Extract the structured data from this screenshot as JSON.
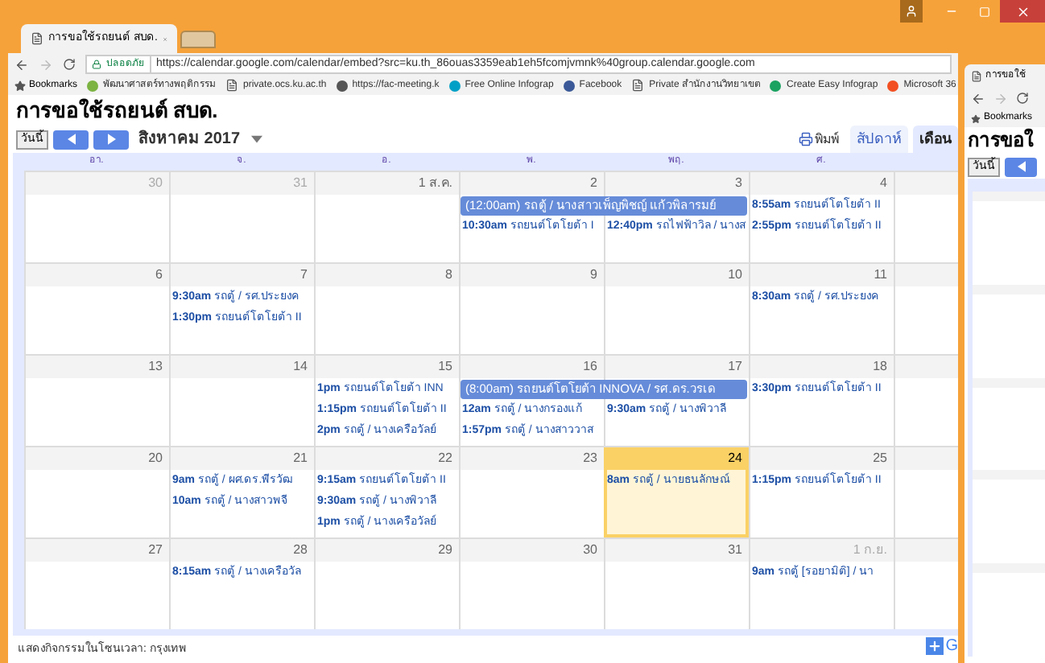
{
  "browser": {
    "tabs": [
      {
        "title": "การขอใช้รถยนต์ สบด.",
        "selected": true
      },
      {
        "selected": false
      }
    ],
    "address": {
      "secure_label": "ปลอดภัย",
      "url": "https://calendar.google.com/calendar/embed?src=ku.th_86ouas3359eab1eh5fcomjvmnk%40group.calendar.google.com"
    },
    "bookmarks_label": "Bookmarks",
    "bookmarks": [
      {
        "kind": "badge",
        "color": "#7cb342",
        "label": "พัฒนาศาสตร์ทางพฤติกรรม"
      },
      {
        "kind": "doc",
        "label": "private.ocs.ku.ac.th"
      },
      {
        "kind": "badge",
        "color": "#555555",
        "label": "https://fac-meeting.k"
      },
      {
        "kind": "badge",
        "color": "#00a0c6",
        "label": "Free Online Infograp"
      },
      {
        "kind": "badge",
        "color": "#3b5998",
        "label": "Facebook"
      },
      {
        "kind": "doc",
        "label": "Private สำนักงานวิทยาเขต"
      },
      {
        "kind": "badge",
        "color": "#1aa260",
        "label": "Create Easy Infograp"
      },
      {
        "kind": "badge",
        "color": "#f25022",
        "label": "Microsoft 36"
      }
    ]
  },
  "page": {
    "title": "การขอใช้รถยนต์ สบด.",
    "today_button": "วันนี้",
    "month": "สิงหาคม 2017",
    "print": "พิมพ์",
    "view_tabs": [
      {
        "label": "สัปดาห์",
        "selected": false
      },
      {
        "label": "เดือน",
        "selected": true
      }
    ]
  },
  "calendar": {
    "weekdays": [
      "อา.",
      "จ.",
      "อ.",
      "พ.",
      "พฤ.",
      "ศ."
    ],
    "weeks": [
      {
        "days": [
          {
            "date": "30",
            "other_month": true,
            "today": false
          },
          {
            "date": "31",
            "other_month": true,
            "today": false
          },
          {
            "date": "1 ส.ค.",
            "other_month": false,
            "today": false
          },
          {
            "date": "2",
            "other_month": false,
            "today": false,
            "events": [
              {
                "kind": "multiday",
                "title": "(12:00am) รถตู้ / นางสาวเพ็ญพิชญ์ แก้วพิลารมย์"
              },
              {
                "kind": "timed",
                "time": "10:30am",
                "title": "รถยนต์โตโยต้า I"
              }
            ]
          },
          {
            "date": "3",
            "other_month": false,
            "today": false,
            "events": [
              {
                "kind": "continued"
              },
              {
                "kind": "timed",
                "time": "12:40pm",
                "title": "รถไฟฟ้าวิล / นางส"
              }
            ]
          },
          {
            "date": "4",
            "other_month": false,
            "today": false,
            "events": [
              {
                "kind": "timed",
                "time": "8:55am",
                "title": "รถยนต์โตโยต้า II"
              },
              {
                "kind": "timed",
                "time": "2:55pm",
                "title": "รถยนต์โตโยต้า II"
              }
            ]
          }
        ]
      },
      {
        "days": [
          {
            "date": "6",
            "other_month": false,
            "today": false
          },
          {
            "date": "7",
            "other_month": false,
            "today": false,
            "events": [
              {
                "kind": "timed",
                "time": "9:30am",
                "title": "รถตู้ / รศ.ประยงค"
              },
              {
                "kind": "timed",
                "time": "1:30pm",
                "title": "รถยนต์โตโยต้า II"
              }
            ]
          },
          {
            "date": "8",
            "other_month": false,
            "today": false
          },
          {
            "date": "9",
            "other_month": false,
            "today": false
          },
          {
            "date": "10",
            "other_month": false,
            "today": false
          },
          {
            "date": "11",
            "other_month": false,
            "today": false,
            "events": [
              {
                "kind": "timed",
                "time": "8:30am",
                "title": "รถตู้ / รศ.ประยงค"
              }
            ]
          }
        ]
      },
      {
        "days": [
          {
            "date": "13",
            "other_month": false,
            "today": false
          },
          {
            "date": "14",
            "other_month": false,
            "today": false
          },
          {
            "date": "15",
            "other_month": false,
            "today": false,
            "events": [
              {
                "kind": "timed",
                "time": "1pm",
                "title": "รถยนต์โตโยต้า INN"
              },
              {
                "kind": "timed",
                "time": "1:15pm",
                "title": "รถยนต์โตโยต้า II"
              },
              {
                "kind": "timed",
                "time": "2pm",
                "title": "รถตู้ / นางเครือวัลย์"
              }
            ]
          },
          {
            "date": "16",
            "other_month": false,
            "today": false,
            "events": [
              {
                "kind": "multiday",
                "title": "(8:00am) รถยนต์โตโยต้า INNOVA / รศ.ดร.วรเด"
              },
              {
                "kind": "timed",
                "time": "12am",
                "title": "รถตู้ / นางกรองแก้"
              },
              {
                "kind": "timed",
                "time": "1:57pm",
                "title": "รถตู้ / นางสาววาส"
              }
            ]
          },
          {
            "date": "17",
            "other_month": false,
            "today": false,
            "events": [
              {
                "kind": "continued"
              },
              {
                "kind": "timed",
                "time": "9:30am",
                "title": "รถตู้ / นางพิวาลี"
              }
            ]
          },
          {
            "date": "18",
            "other_month": false,
            "today": false,
            "events": [
              {
                "kind": "timed",
                "time": "3:30pm",
                "title": "รถยนต์โตโยต้า II"
              }
            ]
          }
        ]
      },
      {
        "days": [
          {
            "date": "20",
            "other_month": false,
            "today": false
          },
          {
            "date": "21",
            "other_month": false,
            "today": false,
            "events": [
              {
                "kind": "timed",
                "time": "9am",
                "title": "รถตู้ / ผศ.ดร.พีรวัฒ"
              },
              {
                "kind": "timed",
                "time": "10am",
                "title": "รถตู้ / นางสาวพจี"
              }
            ]
          },
          {
            "date": "22",
            "other_month": false,
            "today": false,
            "events": [
              {
                "kind": "timed",
                "time": "9:15am",
                "title": "รถยนต์โตโยต้า II"
              },
              {
                "kind": "timed",
                "time": "9:30am",
                "title": "รถตู้ / นางพิวาลี"
              },
              {
                "kind": "timed",
                "time": "1pm",
                "title": "รถตู้ / นางเครือวัลย์"
              }
            ]
          },
          {
            "date": "23",
            "other_month": false,
            "today": false
          },
          {
            "date": "24",
            "other_month": false,
            "today": true,
            "events": [
              {
                "kind": "timed",
                "time": "8am",
                "title": "รถตู้ / นายธนลักษณ์"
              }
            ]
          },
          {
            "date": "25",
            "other_month": false,
            "today": false,
            "events": [
              {
                "kind": "timed",
                "time": "1:15pm",
                "title": "รถยนต์โตโยต้า II"
              }
            ]
          }
        ]
      },
      {
        "days": [
          {
            "date": "27",
            "other_month": false,
            "today": false
          },
          {
            "date": "28",
            "other_month": false,
            "today": false,
            "events": [
              {
                "kind": "timed",
                "time": "8:15am",
                "title": "รถตู้ / นางเครือวัล"
              }
            ]
          },
          {
            "date": "29",
            "other_month": false,
            "today": false
          },
          {
            "date": "30",
            "other_month": false,
            "today": false
          },
          {
            "date": "31",
            "other_month": false,
            "today": false
          },
          {
            "date": "1 ก.ย.",
            "other_month": true,
            "today": false,
            "events": [
              {
                "kind": "timed",
                "time": "9am",
                "title": "รถตู้ [รอยามิติ] / นา"
              }
            ]
          }
        ]
      }
    ]
  },
  "footer": {
    "timezone_note": "แสดงกิจกรรมในโซนเวลา: กรุงเทพ",
    "badge_text": "G"
  },
  "second_window": {
    "tab_title": "การขอใช้",
    "bookmarks_label": "Bookmarks",
    "page_title": "การขอใ",
    "today_button": "วันนี้"
  }
}
